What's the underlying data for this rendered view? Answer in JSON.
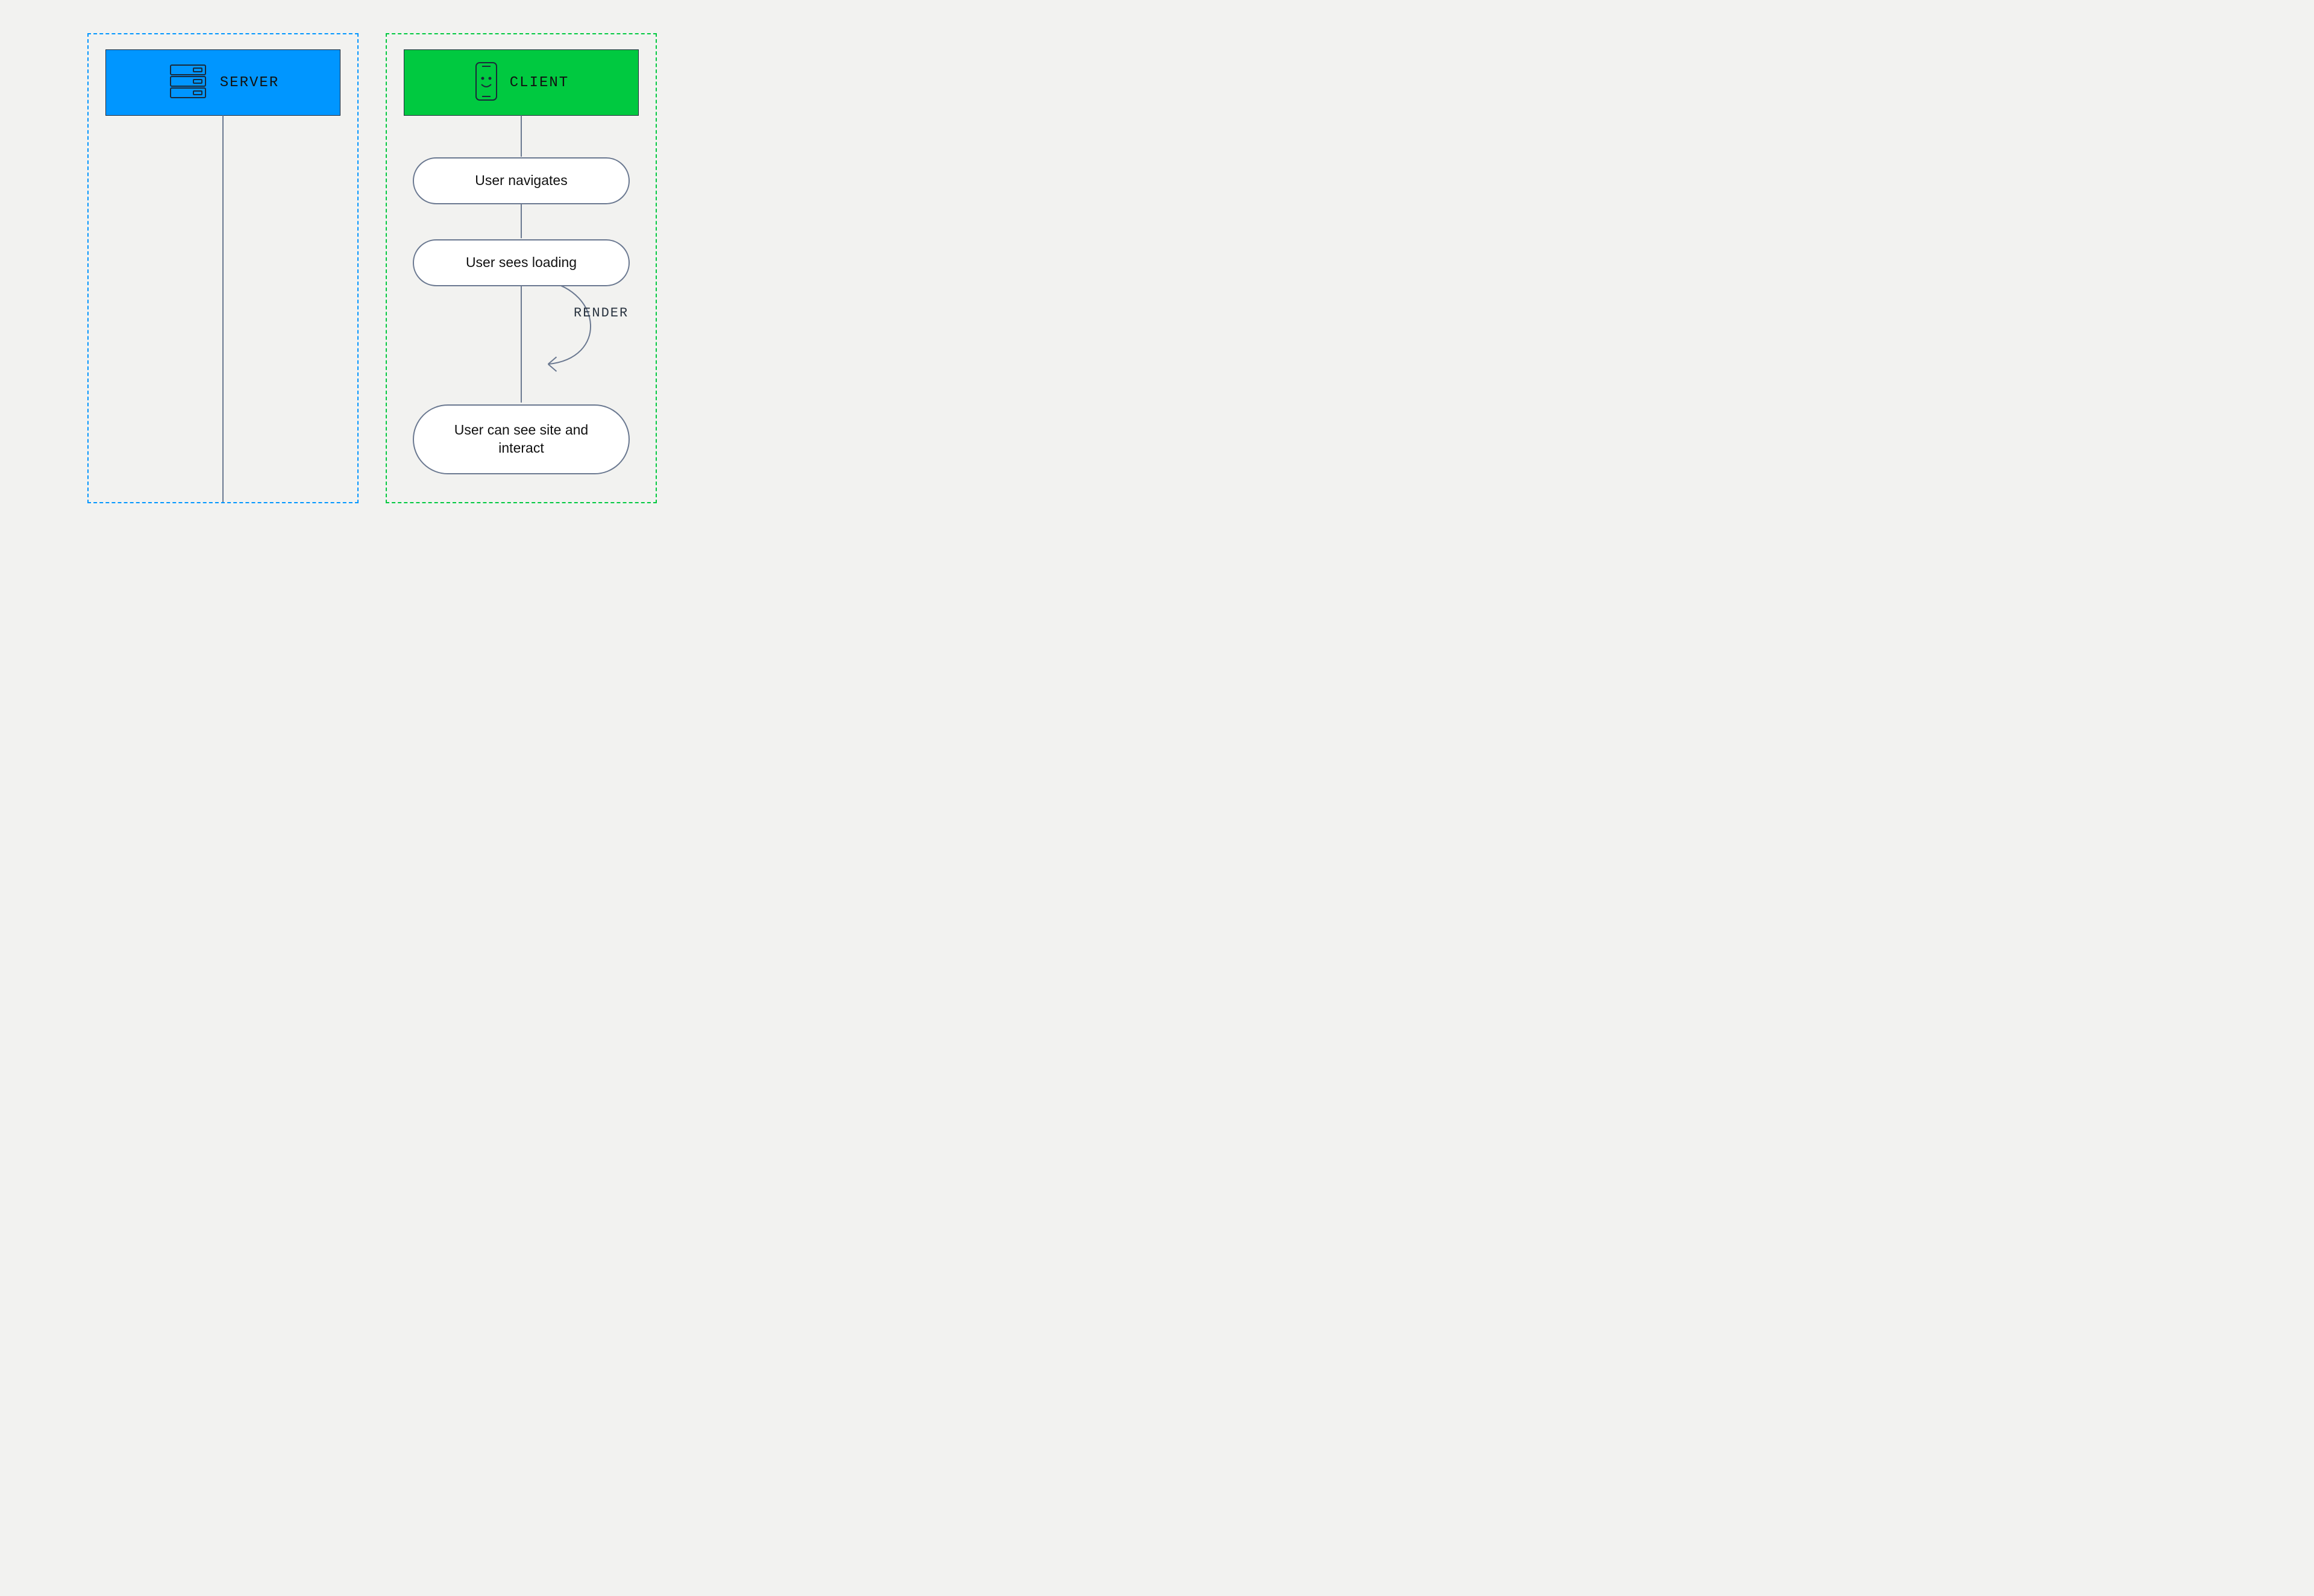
{
  "server": {
    "label": "SERVER"
  },
  "client": {
    "label": "CLIENT",
    "steps": [
      "User navigates",
      "User sees loading",
      "User can see site and interact"
    ],
    "transition_label": "RENDER"
  }
}
